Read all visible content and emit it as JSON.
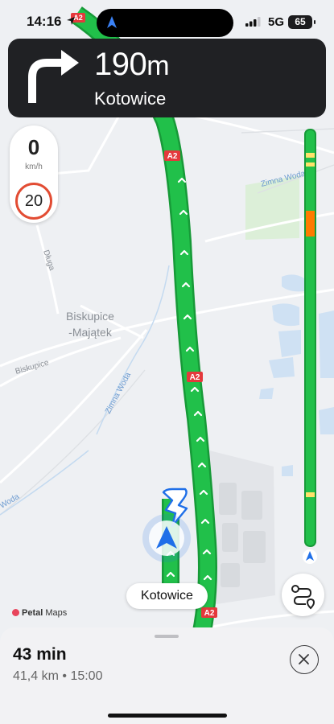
{
  "status_bar": {
    "time": "14:16",
    "network": "5G",
    "battery": "65"
  },
  "navigation": {
    "distance_value": "190",
    "distance_unit": "m",
    "street": "Kotowice",
    "maneuver_icon": "turn-right-arrow"
  },
  "speed": {
    "current": "0",
    "unit": "km/h",
    "limit": "20"
  },
  "map": {
    "labels": {
      "biskupice_line1": "Biskupice",
      "biskupice_line2": "-Majątek",
      "dluga": "Długa",
      "biskupice_road": "Biskupice",
      "zimna_woda_1": "Zimna Woda",
      "zimna_woda_2": "Zimna Woda",
      "zimna_woda_3": "Woda"
    },
    "road_shield": "A2",
    "destination_label": "Kotowice",
    "attribution_brand": "Petal",
    "attribution_suffix": "Maps"
  },
  "trip": {
    "duration": "43 min",
    "distance": "41,4 km",
    "separator": "•",
    "arrival": "15:00"
  },
  "colors": {
    "route": "#21c04a",
    "route_edge": "#179a38",
    "congestion": "#ff7a00",
    "slow": "#ffe26a",
    "accent": "#1f6fe8",
    "banner": "#202124"
  }
}
